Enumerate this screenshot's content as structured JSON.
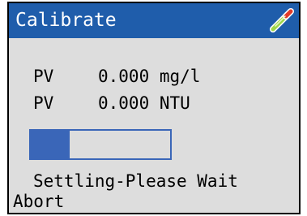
{
  "window": {
    "title": "Calibrate",
    "icon": "probe-icon"
  },
  "readings": [
    {
      "label": "PV",
      "value": "0.000 mg/l"
    },
    {
      "label": "PV",
      "value": "0.000 NTU"
    }
  ],
  "progress": {
    "fraction": 0.28
  },
  "status": {
    "message": "Settling-Please Wait"
  },
  "actions": {
    "abort_label": "Abort"
  },
  "colors": {
    "title_bar": "#1f5dab",
    "background": "#dddddd",
    "progress": "#3a66b8"
  }
}
